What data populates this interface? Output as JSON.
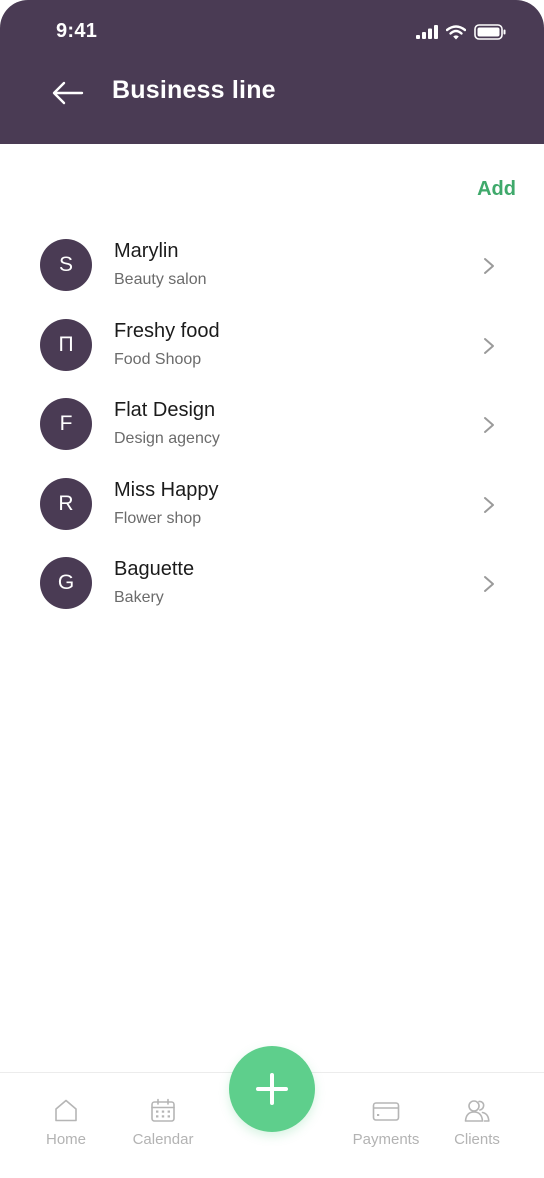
{
  "status_bar": {
    "time": "9:41"
  },
  "header": {
    "title": "Business line"
  },
  "actions": {
    "add_label": "Add"
  },
  "businesses": [
    {
      "initial": "S",
      "name": "Marylin",
      "type": "Beauty salon"
    },
    {
      "initial": "П",
      "name": "Freshy food",
      "type": "Food Shoop"
    },
    {
      "initial": "F",
      "name": "Flat Design",
      "type": "Design agency"
    },
    {
      "initial": "R",
      "name": "Miss Happy",
      "type": "Flower shop"
    },
    {
      "initial": "G",
      "name": "Baguette",
      "type": "Bakery"
    }
  ],
  "tab_bar": {
    "items": [
      {
        "label": "Home",
        "icon": "home-icon"
      },
      {
        "label": "Calendar",
        "icon": "calendar-icon"
      },
      {
        "label": "Payments",
        "icon": "card-icon"
      },
      {
        "label": "Clients",
        "icon": "users-icon"
      }
    ],
    "fab_icon": "plus-icon"
  },
  "colors": {
    "header_bg": "#4a3b54",
    "accent_green": "#3fa96b",
    "fab_green": "#5ecf8c",
    "avatar_bg": "#4a3b54"
  }
}
